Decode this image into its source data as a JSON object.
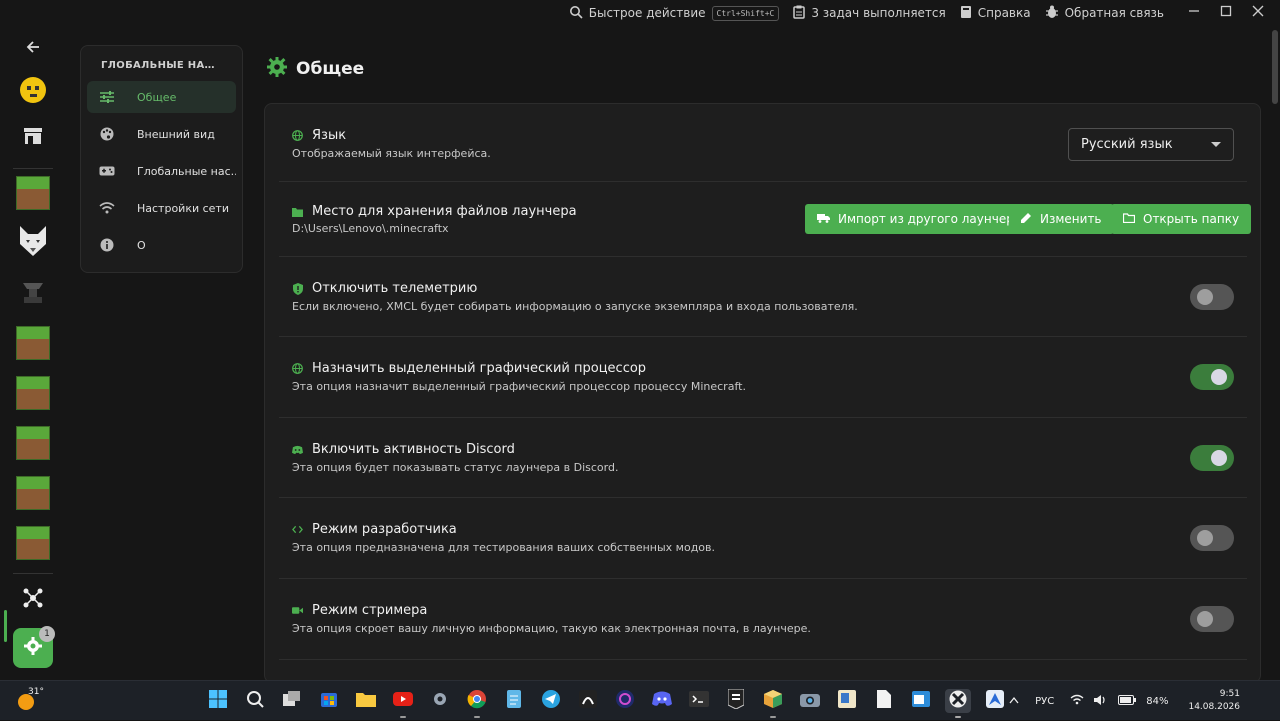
{
  "titlebar": {
    "quick_action_label": "Быстрое действие",
    "quick_action_shortcut": "Ctrl+Shift+C",
    "tasks_label": "3 задач выполняется",
    "help_label": "Справка",
    "feedback_label": "Обратная связь"
  },
  "rail": {
    "settings_badge": "1"
  },
  "nav": {
    "title": "ГЛОБАЛЬНЫЕ НАСТР...",
    "items": [
      {
        "label": "Общее"
      },
      {
        "label": "Внешний вид"
      },
      {
        "label": "Глобальные нас..."
      },
      {
        "label": "Настройки сети"
      },
      {
        "label": "О"
      }
    ]
  },
  "page": {
    "title": "Общее"
  },
  "settings": {
    "language": {
      "title": "Язык",
      "subtitle": "Отображаемый язык интерфейса.",
      "selected": "Русский язык"
    },
    "storage": {
      "title": "Место для хранения файлов лаунчера",
      "path": "D:\\Users\\Lenovo\\.minecraftx",
      "import_label": "Импорт из другого лаунчера",
      "change_label": "Изменить",
      "open_label": "Открыть папку"
    },
    "telemetry": {
      "title": "Отключить телеметрию",
      "subtitle": "Если включено, XMCL будет собирать информацию о запуске экземпляра и входа пользователя.",
      "enabled": false
    },
    "gpu": {
      "title": "Назначить выделенный графический процессор",
      "subtitle": "Эта опция назначит выделенный графический процессор процессу Minecraft.",
      "enabled": true
    },
    "discord": {
      "title": "Включить активность Discord",
      "subtitle": "Эта опция будет показывать статус лаунчера в Discord.",
      "enabled": true
    },
    "developer": {
      "title": "Режим разработчика",
      "subtitle": "Эта опция предназначена для тестирования ваших собственных модов.",
      "enabled": false
    },
    "streamer": {
      "title": "Режим стримера",
      "subtitle": "Эта опция скроет вашу личную информацию, такую как электронная почта, в лаунчере.",
      "enabled": false
    }
  },
  "taskbar": {
    "temperature": "31°",
    "language": "РУС",
    "battery": "84%",
    "time": "9:51",
    "date": "14.08.2026"
  },
  "colors": {
    "accent": "#4caf50",
    "background": "#161616",
    "panel": "#1e1e1e"
  }
}
